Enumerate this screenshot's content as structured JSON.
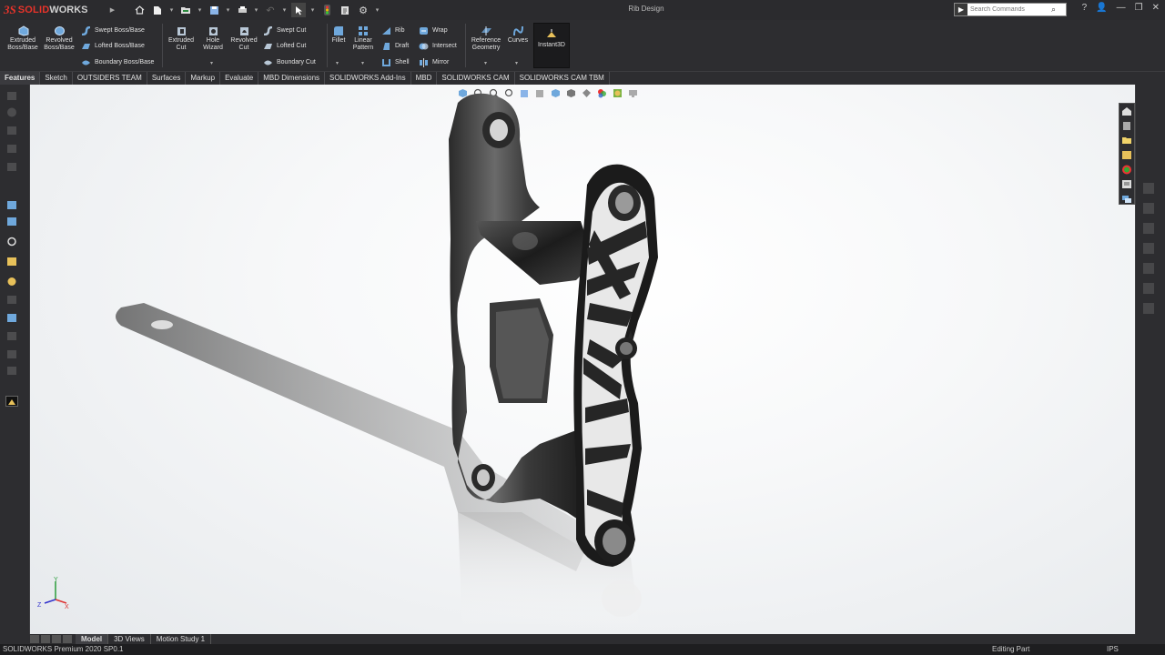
{
  "app": {
    "brand_ds": "3S",
    "brand_solid": "SOLID",
    "brand_works": "WORKS",
    "document_title": "Rib Design"
  },
  "search": {
    "placeholder": "Search Commands"
  },
  "ribbon": {
    "extruded_boss": [
      "Extruded",
      "Boss/Base"
    ],
    "revolved_boss": [
      "Revolved",
      "Boss/Base"
    ],
    "swept_boss": "Swept Boss/Base",
    "lofted_boss": "Lofted Boss/Base",
    "boundary_boss": "Boundary Boss/Base",
    "extruded_cut": [
      "Extruded",
      "Cut"
    ],
    "hole_wizard": [
      "Hole",
      "Wizard"
    ],
    "revolved_cut": [
      "Revolved",
      "Cut"
    ],
    "swept_cut": "Swept Cut",
    "lofted_cut": "Lofted Cut",
    "boundary_cut": "Boundary Cut",
    "fillet": "Fillet",
    "linear_pattern": [
      "Linear",
      "Pattern"
    ],
    "rib": "Rib",
    "draft": "Draft",
    "shell": "Shell",
    "wrap": "Wrap",
    "intersect": "Intersect",
    "mirror": "Mirror",
    "reference_geometry": [
      "Reference",
      "Geometry"
    ],
    "curves": "Curves",
    "instant3d": "Instant3D"
  },
  "tabs": [
    "Features",
    "Sketch",
    "OUTSIDERS TEAM",
    "Surfaces",
    "Markup",
    "Evaluate",
    "MBD Dimensions",
    "SOLIDWORKS Add-Ins",
    "MBD",
    "SOLIDWORKS CAM",
    "SOLIDWORKS CAM TBM"
  ],
  "active_tab": "Features",
  "bottom_tabs": [
    "Model",
    "3D Views",
    "Motion Study 1"
  ],
  "triad": {
    "y": "Y",
    "z": "Z",
    "x": "X"
  },
  "status": {
    "version": "SOLIDWORKS Premium 2020 SP0.1",
    "mode": "Editing Part",
    "units": "IPS"
  },
  "colors": {
    "accent_red": "#e8332a",
    "ui_dark": "#2d2d30",
    "part_metal": "#3a3a3a"
  }
}
